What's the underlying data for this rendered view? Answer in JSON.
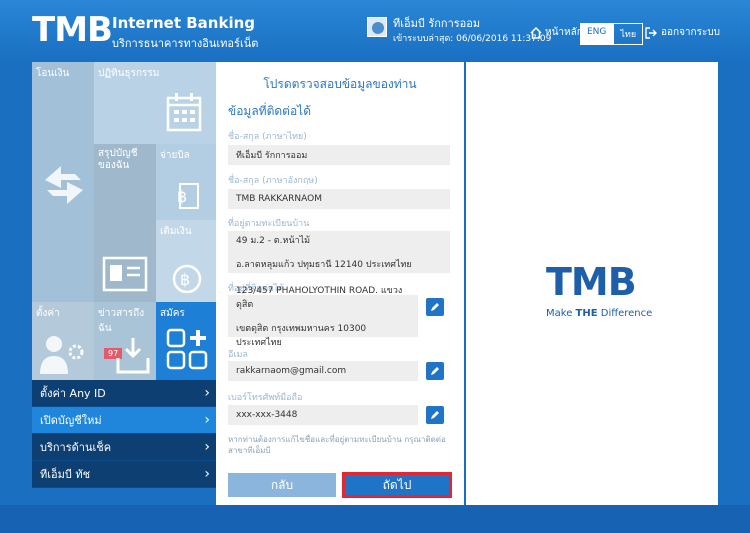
{
  "header": {
    "logo": "TMB",
    "title": "Internet Banking",
    "subtitle": "บริการธนาคารทางอินเทอร์เน็ต",
    "user_name": "ทีเอ็มบี รักการออม",
    "last_login": "เข้าระบบล่าสุด: 06/06/2016 11:37:09",
    "home_label": "หน้าหลัก",
    "lang_en": "ENG",
    "lang_th": "ไทย",
    "logout_label": "ออกจากระบบ"
  },
  "tiles": {
    "transfer": "โอนเงิน",
    "history": "ปฏิทินธุรกรรม",
    "summary": "สรุปบัญชีของฉัน",
    "bill": "จ่ายบิล",
    "topup": "เติมเงิน",
    "settings": "ตั้งค่า",
    "news": "ข่าวสารถึงฉัน",
    "news_badge": "97",
    "apply": "สมัคร"
  },
  "menu": [
    {
      "label": "ตั้งค่า Any ID"
    },
    {
      "label": "เปิดบัญชีใหม่"
    },
    {
      "label": "บริการด้านเช็ค"
    },
    {
      "label": "ทีเอ็มบี ทัช"
    }
  ],
  "form": {
    "title": "โปรดตรวจสอบข้อมูลของท่าน",
    "section": "ข้อมูลที่ติดต่อได้",
    "name_th_label": "ชื่อ-สกุล (ภาษาไทย)",
    "name_th": "ทีเอ็มบี รักการออม",
    "name_en_label": "ชื่อ-สกุล (ภาษาอังกฤษ)",
    "name_en": "TMB RAKKARNAOM",
    "reg_addr_label": "ที่อยู่ตามทะเบียนบ้าน",
    "reg_addr_1": "49 ม.2 - ต.หน้าไม้",
    "reg_addr_2": "อ.ลาดหลุมแก้ว ปทุมธานี 12140 ประเทศไทย",
    "contact_addr_label": "ที่อยู่ที่ติดต่อได้",
    "contact_addr_1": "123/457 PHAHOLYOTHIN ROAD. แขวงดุสิต",
    "contact_addr_2": "เขตดุสิต กรุงเทพมหานคร 10300 ประเทศไทย",
    "email_label": "อีเมล",
    "email": "rakkarnaom@gmail.com",
    "mobile_label": "เบอร์โทรศัพท์มือถือ",
    "mobile": "xxx-xxx-3448",
    "note": "หากท่านต้องการแก้ไขชื่อและที่อยู่ตามทะเบียนบ้าน กรุณาติดต่อสาขาทีเอ็มบี",
    "back_label": "กลับ",
    "next_label": "ถัดไป"
  },
  "brand": {
    "logo": "TMB",
    "tagline_pre": "Make ",
    "tagline_bold": "THE",
    "tagline_post": " Difference"
  },
  "colors": {
    "primary": "#1a6fc1",
    "highlight_border": "#e32631"
  }
}
